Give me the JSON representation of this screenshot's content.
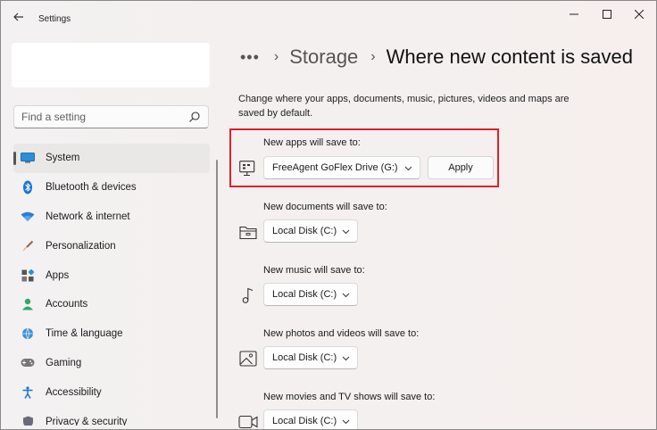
{
  "window": {
    "title": "Settings"
  },
  "sidebar": {
    "search_placeholder": "Find a setting",
    "items": [
      {
        "label": "System",
        "icon": "monitor-icon",
        "active": true
      },
      {
        "label": "Bluetooth & devices",
        "icon": "bluetooth-icon"
      },
      {
        "label": "Network & internet",
        "icon": "wifi-icon"
      },
      {
        "label": "Personalization",
        "icon": "brush-icon"
      },
      {
        "label": "Apps",
        "icon": "apps-grid-icon"
      },
      {
        "label": "Accounts",
        "icon": "person-icon"
      },
      {
        "label": "Time & language",
        "icon": "globe-clock-icon"
      },
      {
        "label": "Gaming",
        "icon": "gamepad-icon"
      },
      {
        "label": "Accessibility",
        "icon": "accessibility-icon"
      },
      {
        "label": "Privacy & security",
        "icon": "shield-icon"
      }
    ]
  },
  "breadcrumb": {
    "parent": "Storage",
    "current": "Where new content is saved"
  },
  "description": "Change where your apps, documents, music, pictures, videos and maps are saved by default.",
  "sections": {
    "apps": {
      "label": "New apps will save to:",
      "value": "FreeAgent GoFlex Drive (G:)",
      "apply": "Apply",
      "icon": "app-window-icon"
    },
    "documents": {
      "label": "New documents will save to:",
      "value": "Local Disk (C:)",
      "icon": "folder-icon"
    },
    "music": {
      "label": "New music will save to:",
      "value": "Local Disk (C:)",
      "icon": "music-note-icon"
    },
    "photos": {
      "label": "New photos and videos will save to:",
      "value": "Local Disk (C:)",
      "icon": "picture-icon"
    },
    "movies": {
      "label": "New movies and TV shows will save to:",
      "value": "Local Disk (C:)",
      "icon": "video-camera-icon"
    }
  },
  "colors": {
    "highlight": "#e0202a",
    "bluetooth": "#1a73d9",
    "accent": "#0067c0"
  }
}
